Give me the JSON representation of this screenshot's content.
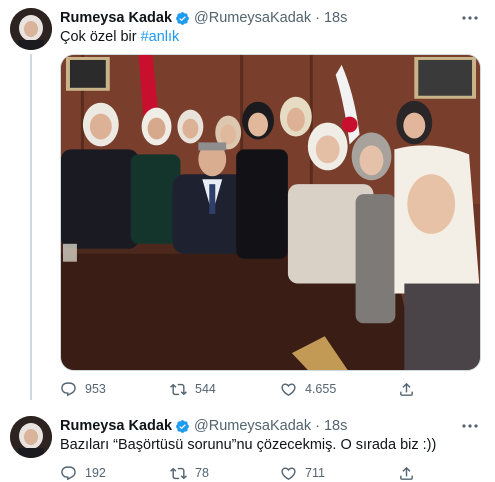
{
  "tweets": [
    {
      "author": {
        "name": "Rumeysa Kadak",
        "handle": "@RumeysaKadak",
        "verified": true
      },
      "separator": "·",
      "time": "18s",
      "text_plain": "Çok özel bir ",
      "text_hashtag": "#anlık",
      "counts": {
        "replies": "953",
        "retweets": "544",
        "likes": "4.655"
      }
    },
    {
      "author": {
        "name": "Rumeysa Kadak",
        "handle": "@RumeysaKadak",
        "verified": true
      },
      "separator": "·",
      "time": "18s",
      "text": "Bazıları “Başörtüsü sorunu”nu çözecekmiş. O sırada biz :))",
      "counts": {
        "replies": "192",
        "retweets": "78",
        "likes": "711"
      }
    }
  ],
  "colors": {
    "accent": "#1d9bf0",
    "text": "#0f1419",
    "secondary": "#536471",
    "border": "#cfd9de"
  },
  "icons": {
    "more": "more-dots-icon",
    "reply": "reply-icon",
    "retweet": "retweet-icon",
    "like": "heart-icon",
    "share": "share-icon",
    "verified": "verified-badge-icon"
  }
}
